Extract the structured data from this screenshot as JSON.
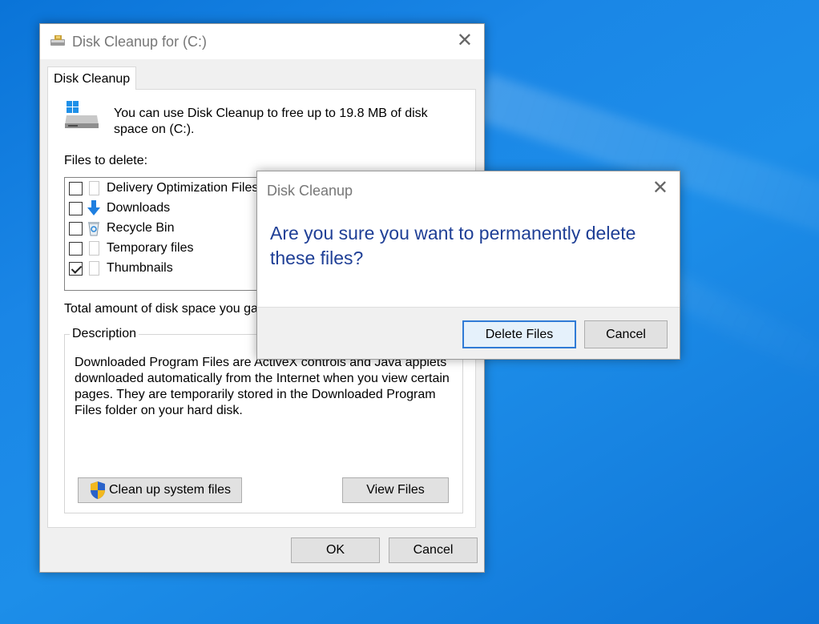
{
  "main_window": {
    "title": "Disk Cleanup for  (C:)",
    "tab": "Disk Cleanup",
    "intro_text": "You can use Disk Cleanup to free up to 19.8 MB of disk space on  (C:).",
    "files_label": "Files to delete:",
    "files": [
      {
        "label": "Delivery Optimization Files",
        "checked": false,
        "icon": "document-icon"
      },
      {
        "label": "Downloads",
        "checked": false,
        "icon": "download-arrow-icon"
      },
      {
        "label": "Recycle Bin",
        "checked": false,
        "icon": "recycle-bin-icon"
      },
      {
        "label": "Temporary files",
        "checked": false,
        "icon": "document-icon"
      },
      {
        "label": "Thumbnails",
        "checked": true,
        "icon": "document-icon"
      }
    ],
    "total_label": "Total amount of disk space you gai",
    "description_legend": "Description",
    "description_text": "Downloaded Program Files are ActiveX controls and Java applets downloaded automatically from the Internet when you view certain pages. They are temporarily stored in the Downloaded Program Files folder on your hard disk.",
    "clean_system_label": "Clean up system files",
    "view_files_label": "View Files",
    "ok_label": "OK",
    "cancel_label": "Cancel"
  },
  "dialog": {
    "title": "Disk Cleanup",
    "message": "Are you sure you want to permanently delete these files?",
    "delete_label": "Delete Files",
    "cancel_label": "Cancel"
  },
  "colors": {
    "desktop": "#1a86e6",
    "dialog_message": "#1f3f96",
    "default_button_border": "#2f7bd6"
  }
}
